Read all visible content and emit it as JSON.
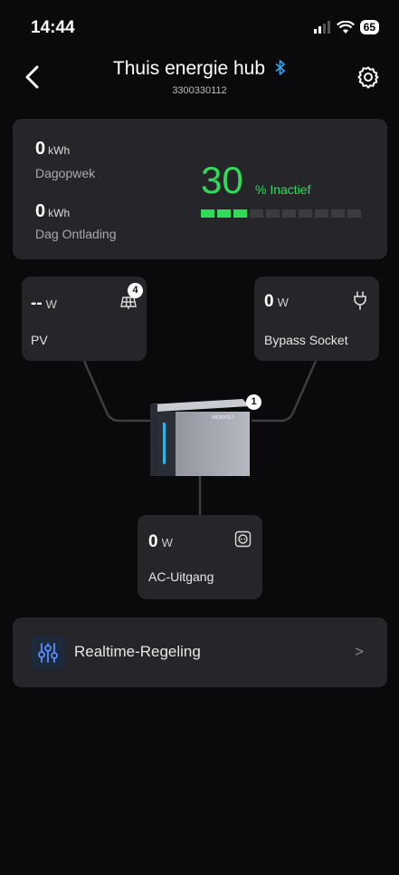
{
  "status_bar": {
    "time": "14:44",
    "battery": "65"
  },
  "header": {
    "title": "Thuis energie hub",
    "serial": "3300330112"
  },
  "summary": {
    "dagopwek_value": "0",
    "dagopwek_unit": "kWh",
    "dagopwek_label": "Dagopwek",
    "dag_ontlading_value": "0",
    "dag_ontlading_unit": "kWh",
    "dag_ontlading_label": "Dag Ontlading",
    "percent": "30",
    "status_label": "% Inactief",
    "level_fraction": 0.3
  },
  "nodes": {
    "pv": {
      "value": "--",
      "unit": "W",
      "label": "PV",
      "badge": "4"
    },
    "bypass": {
      "value": "0",
      "unit": "W",
      "label": "Bypass Socket"
    },
    "device": {
      "badge": "1",
      "brand": "INDRVOLT"
    },
    "ac": {
      "value": "0",
      "unit": "W",
      "label": "AC-Uitgang"
    }
  },
  "realtime": {
    "label": "Realtime-Regeling",
    "chevron": ">"
  },
  "colors": {
    "accent_green": "#2fdc5a",
    "bluetooth": "#2aa8ff",
    "card": "#26262a"
  }
}
